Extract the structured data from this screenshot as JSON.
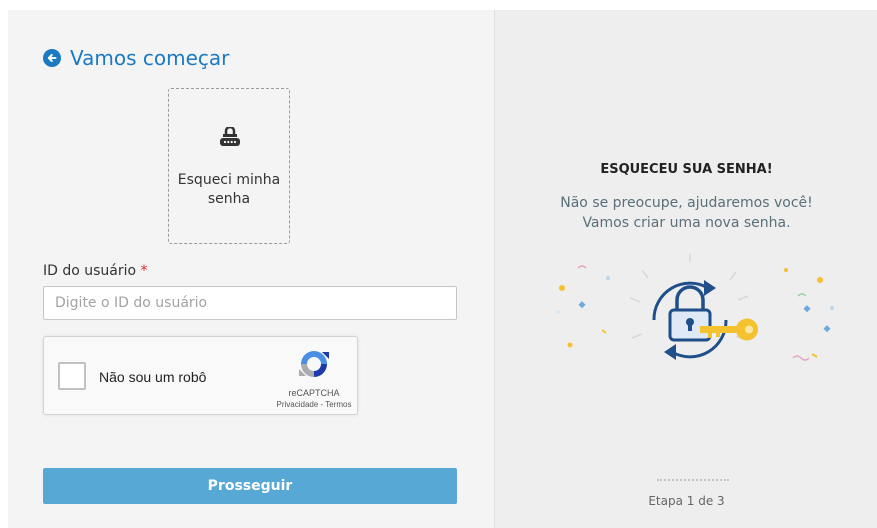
{
  "header": {
    "title": "Vamos começar",
    "back_icon": "arrow-left-circle-icon"
  },
  "option_card": {
    "icon": "lock-password-icon",
    "label_line1": "Esqueci minha",
    "label_line2": "senha"
  },
  "form": {
    "user_id_label": "ID do usuário",
    "required_marker": "*",
    "user_id_placeholder": "Digite o ID do usuário",
    "user_id_value": "",
    "submit_label": "Prosseguir"
  },
  "recaptcha": {
    "checkbox_label": "Não sou um robô",
    "checked": false,
    "brand": "reCAPTCHA",
    "privacy": "Privacidade",
    "separator": " - ",
    "terms": "Termos"
  },
  "info": {
    "title": "ESQUECEU SUA SENHA!",
    "line1": "Não se preocupe, ajudaremos você!",
    "line2": "Vamos criar uma nova senha.",
    "illustration": "lock-key-refresh-icon"
  },
  "progress": {
    "step_text": "Etapa 1 de 3",
    "current": 1,
    "total": 3
  },
  "colors": {
    "accent": "#1b7ac1",
    "button": "#58a8d6",
    "required": "#e0262b",
    "key": "#f3c22e"
  }
}
